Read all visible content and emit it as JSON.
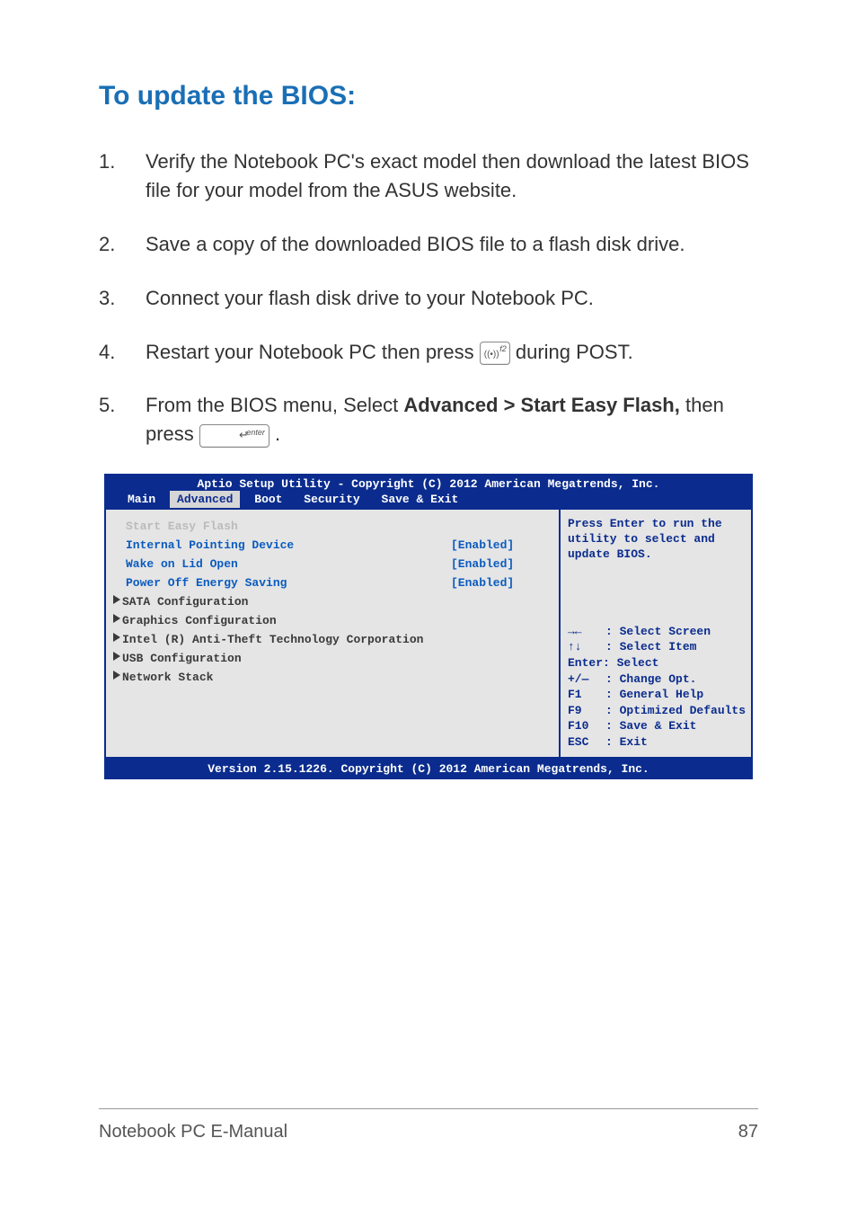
{
  "heading": "To update the BIOS:",
  "steps": {
    "n1": "1.",
    "t1": "Verify the Notebook PC's exact model then download the latest BIOS file for your model from the ASUS website.",
    "n2": "2.",
    "t2": "Save a copy of the downloaded BIOS file to a flash disk drive.",
    "n3": "3.",
    "t3": "Connect your flash disk drive to your Notebook PC.",
    "n4": "4.",
    "t4a": "Restart your Notebook PC then press ",
    "t4b": " during POST.",
    "n5": "5.",
    "t5a": "From the BIOS menu, Select ",
    "t5bold": "Advanced > Start Easy Flash,",
    "t5b": " then press ",
    "t5c": "."
  },
  "key_f2": {
    "wifi": "((•))",
    "label": "f2"
  },
  "key_enter": {
    "label": "enter",
    "arrow": "↵"
  },
  "bios": {
    "title": "Aptio Setup Utility - Copyright (C) 2012 American Megatrends, Inc.",
    "tabs": {
      "main": "Main",
      "advanced": "Advanced",
      "boot": "Boot",
      "security": "Security",
      "save": "Save & Exit"
    },
    "rows": {
      "r0": {
        "label": "Start Easy Flash",
        "val": ""
      },
      "r1": {
        "label": "Internal Pointing Device",
        "val": "[Enabled]"
      },
      "r2": {
        "label": "Wake on Lid Open",
        "val": "[Enabled]"
      },
      "r3": {
        "label": "Power Off Energy Saving",
        "val": "[Enabled]"
      },
      "r4": {
        "label": "SATA Configuration"
      },
      "r5": {
        "label": "Graphics Configuration"
      },
      "r6": {
        "label": "Intel (R) Anti-Theft Technology Corporation"
      },
      "r7": {
        "label": "USB Configuration"
      },
      "r8": {
        "label": "Network Stack"
      }
    },
    "help_top": "Press Enter to run the utility to select and update BIOS.",
    "hints": {
      "h1k": "→←",
      "h1t": ": Select Screen",
      "h2k": "↑↓",
      "h2t": ": Select Item",
      "h3k": "Enter",
      "h3t": ": Select",
      "h3full": "Enter: Select",
      "h4k": "+/—",
      "h4t": ": Change Opt.",
      "h5k": "F1",
      "h5t": ": General Help",
      "h6k": "F9",
      "h6t": ": Optimized Defaults",
      "h7k": "F10",
      "h7t": ": Save & Exit",
      "h8k": "ESC",
      "h8t": ": Exit"
    },
    "footer": "Version 2.15.1226. Copyright (C) 2012 American Megatrends, Inc."
  },
  "page_footer": {
    "left": "Notebook PC E-Manual",
    "right": "87"
  }
}
